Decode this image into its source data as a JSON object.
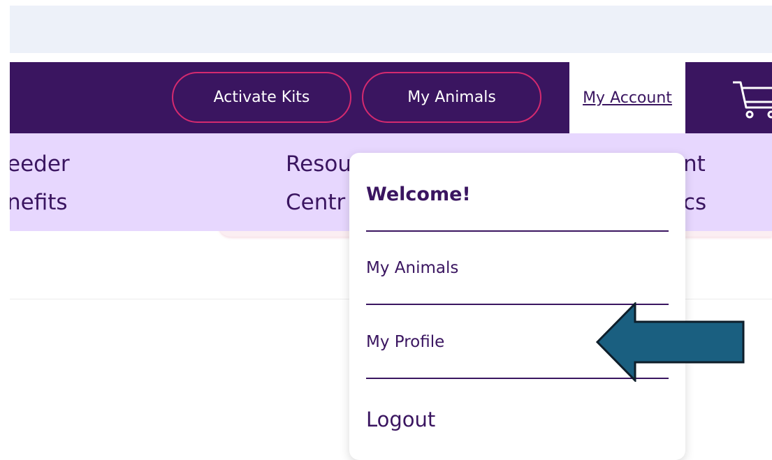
{
  "header": {
    "activate_kits": "Activate Kits",
    "my_animals": "My Animals",
    "my_account": "My Account"
  },
  "subnav": {
    "item1_line1": "eeder",
    "item1_line2": "nefits",
    "item2_line1": "Resou",
    "item2_line2": "Centr",
    "item3_line1": "nt",
    "item3_line2": "cs"
  },
  "dropdown": {
    "welcome": "Welcome!",
    "my_animals": "My Animals",
    "my_profile": "My Profile",
    "logout": "Logout"
  },
  "icons": {
    "cart": "cart-icon",
    "arrow": "arrow-left-icon"
  },
  "colors": {
    "navbar_bg": "#3a1560",
    "pill_border": "#d42a6f",
    "subnav_bg": "#e7d7fe",
    "arrow_fill": "#1a5f80"
  }
}
